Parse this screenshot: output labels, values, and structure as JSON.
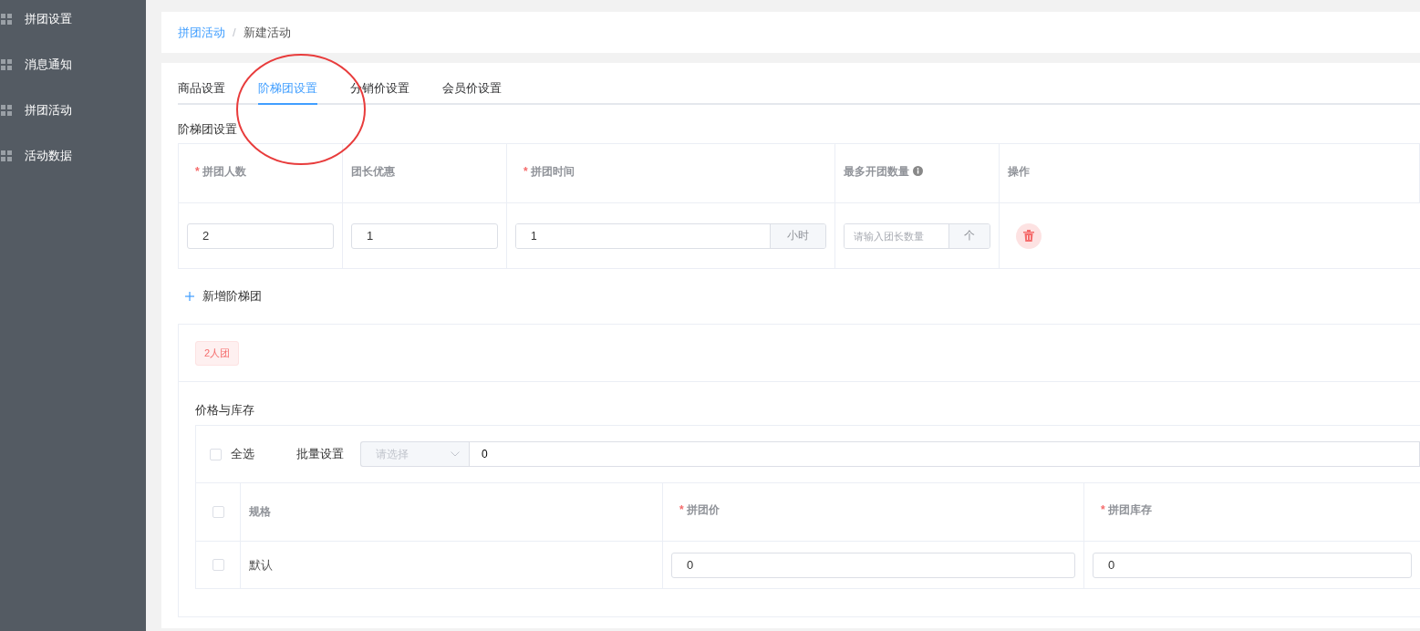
{
  "sidebar": {
    "items": [
      {
        "label": "拼团设置"
      },
      {
        "label": "消息通知"
      },
      {
        "label": "拼团活动"
      },
      {
        "label": "活动数据"
      }
    ]
  },
  "breadcrumb": {
    "items": [
      {
        "label": "拼团活动",
        "kind": "link"
      },
      {
        "label": "新建活动",
        "kind": "current"
      }
    ],
    "separator": "/"
  },
  "tabs": [
    {
      "label": "商品设置",
      "selected": false
    },
    {
      "label": "阶梯团设置",
      "selected": true
    },
    {
      "label": "分销价设置",
      "selected": false
    },
    {
      "label": "会员价设置",
      "selected": false
    }
  ],
  "tier_section": {
    "title": "阶梯团设置",
    "columns": [
      {
        "label": "拼团人数",
        "required_mark": "*",
        "info": false
      },
      {
        "label": "团长优惠",
        "info": false
      },
      {
        "label": "拼团时间",
        "required_mark": "*",
        "info": false
      },
      {
        "label": "最多开团数量",
        "info": true
      },
      {
        "label": "操作",
        "info": false
      }
    ],
    "rows": [
      {
        "group_size": "2",
        "leader_discount": "1",
        "duration": "1",
        "duration_unit": "小时",
        "max_groups_placeholder": "请输入团长数量",
        "max_groups_unit": "个"
      }
    ],
    "add_button": "新增阶梯团"
  },
  "tier_tags": [
    {
      "label": "2人团",
      "selected": true
    }
  ],
  "price_stock": {
    "title": "价格与库存",
    "select_all": {
      "label": "全选",
      "checked": false
    },
    "batch": {
      "label": "批量设置",
      "select_placeholder": "请选择",
      "value": "0"
    },
    "header_checked": false,
    "columns": [
      {
        "label": "规格"
      },
      {
        "label": "拼团价",
        "required_mark": "*"
      },
      {
        "label": "拼团库存",
        "required_mark": "*"
      }
    ],
    "rows": [
      {
        "spec": "默认",
        "checked": false,
        "price": "0",
        "stock": "0"
      }
    ]
  }
}
